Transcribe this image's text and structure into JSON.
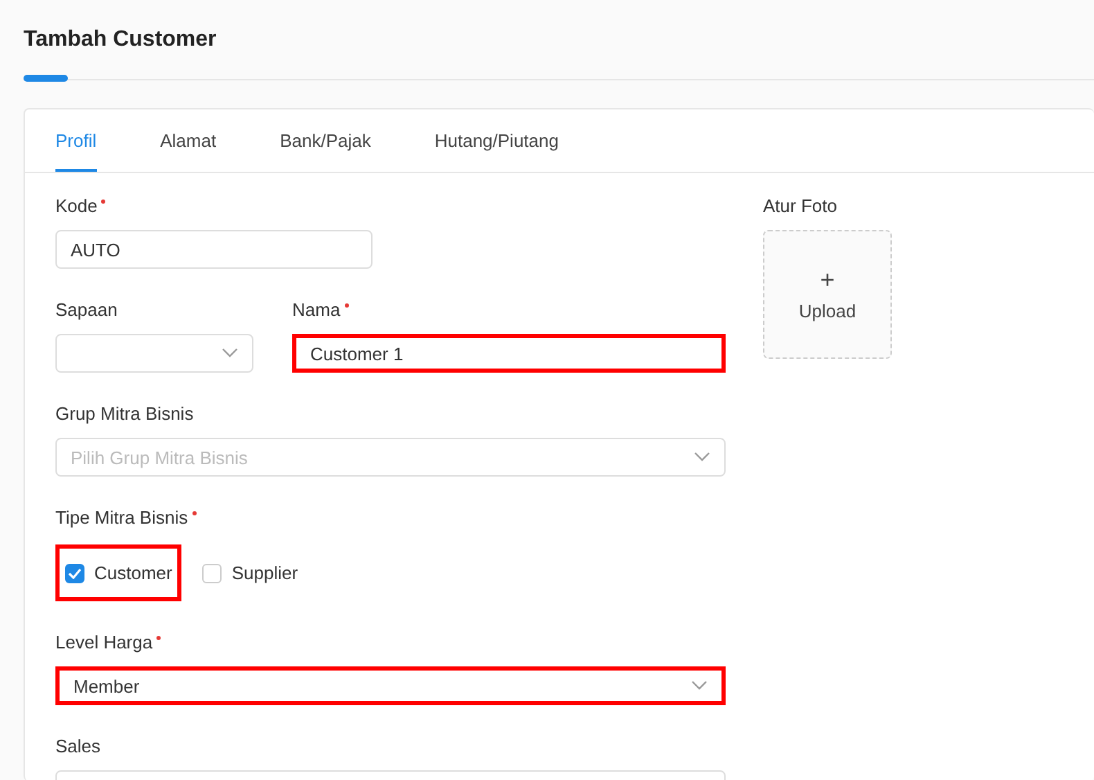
{
  "page": {
    "title": "Tambah Customer"
  },
  "tabs": [
    {
      "label": "Profil",
      "selected": true
    },
    {
      "label": "Alamat",
      "selected": false
    },
    {
      "label": "Bank/Pajak",
      "selected": false
    },
    {
      "label": "Hutang/Piutang",
      "selected": false
    }
  ],
  "form": {
    "rows": [
      [
        {
          "kind": "text",
          "label": "Kode",
          "required": true,
          "value": "AUTO",
          "highlighted": false
        }
      ],
      [
        {
          "kind": "select",
          "label": "Sapaan",
          "required": false,
          "highlighted": false
        },
        {
          "kind": "text",
          "label": "Nama",
          "required": true,
          "value": "Customer 1",
          "highlighted": true
        }
      ],
      [
        {
          "kind": "select",
          "label": "Grup Mitra Bisnis",
          "required": false,
          "placeholder": "Pilih Grup Mitra Bisnis",
          "highlighted": false
        }
      ],
      [
        {
          "kind": "checkboxes",
          "label": "Tipe Mitra Bisnis",
          "required": true,
          "options": [
            {
              "label": "Customer",
              "checked": true,
              "highlighted": true
            },
            {
              "label": "Supplier",
              "checked": false,
              "highlighted": false
            }
          ]
        }
      ],
      [
        {
          "kind": "select",
          "label": "Level Harga",
          "required": true,
          "value": "Member",
          "highlighted": true
        }
      ],
      [
        {
          "kind": "select",
          "label": "Sales",
          "required": false,
          "highlighted": false
        }
      ]
    ]
  },
  "photo": {
    "label": "Atur Foto",
    "plus": "+",
    "button": "Upload"
  }
}
